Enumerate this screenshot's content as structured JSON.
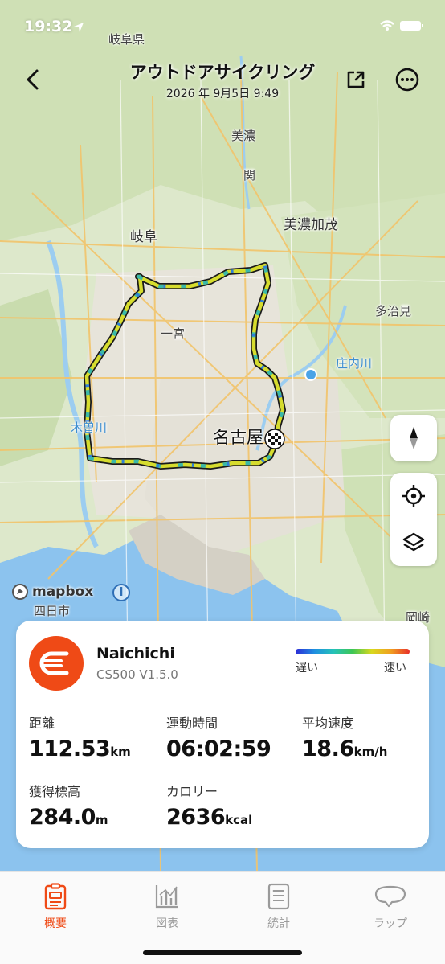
{
  "status": {
    "time": "19:32"
  },
  "header": {
    "title": "アウトドアサイクリング",
    "date": "2026 年 9月5日 9:49"
  },
  "map": {
    "labels": {
      "gifu_pref": "岐阜県",
      "mino": "美濃",
      "seki": "関",
      "gifu": "岐阜",
      "minokamo": "美濃加茂",
      "tajimi": "多治見",
      "ichinomiya": "一宮",
      "shonaigawa": "庄内川",
      "kisogawa": "木曽川",
      "nagoya": "名古屋",
      "yokkaichi": "四日市",
      "okazaki": "岡崎"
    },
    "attribution": "mapbox",
    "info": "i"
  },
  "card": {
    "device_name": "Naichichi",
    "device_model": "CS500  V1.5.0",
    "legend": {
      "slow": "遅い",
      "fast": "速い"
    },
    "stats": {
      "distance": {
        "label": "距離",
        "value": "112.53",
        "unit": "km"
      },
      "duration": {
        "label": "運動時間",
        "value": "06:02:59",
        "unit": ""
      },
      "avg_speed": {
        "label": "平均速度",
        "value": "18.6",
        "unit": "km/h"
      },
      "elevation": {
        "label": "獲得標高",
        "value": "284.0",
        "unit": "m"
      },
      "calories": {
        "label": "カロリー",
        "value": "2636",
        "unit": "kcal"
      }
    }
  },
  "tabs": [
    {
      "label": "概要",
      "icon": "summary-icon",
      "active": true
    },
    {
      "label": "図表",
      "icon": "chart-icon",
      "active": false
    },
    {
      "label": "統計",
      "icon": "list-icon",
      "active": false
    },
    {
      "label": "ラップ",
      "icon": "lap-icon",
      "active": false
    }
  ],
  "colors": {
    "accent": "#ef4a16",
    "inactive": "#9a9a9a",
    "route_fast": "#e8e030",
    "route_slow": "#2f7fd8"
  }
}
